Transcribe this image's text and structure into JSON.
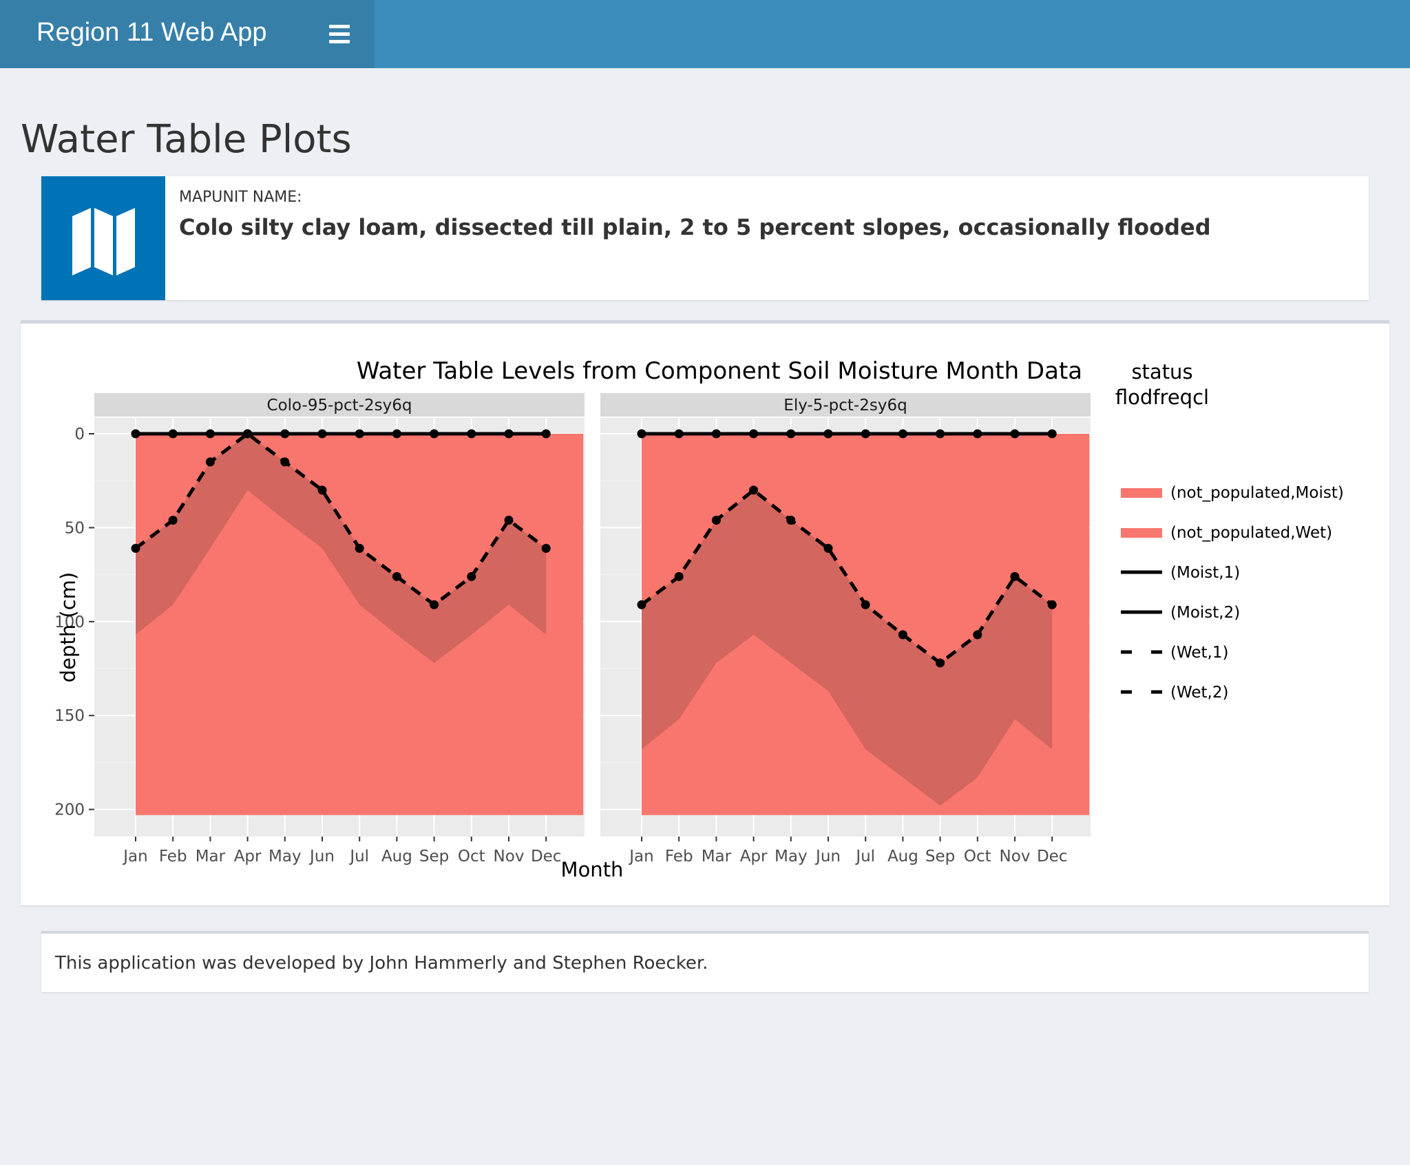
{
  "header": {
    "app_title": "Region 11 Web App",
    "menu_icon": "hamburger-icon"
  },
  "page": {
    "title": "Water Table Plots"
  },
  "mapunit": {
    "icon": "map-icon",
    "label": "MAPUNIT NAME:",
    "name": "Colo silty clay loam, dissected till plain, 2 to 5 percent slopes, occasionally flooded"
  },
  "footer": {
    "text": "This application was developed by John Hammerly and Stephen Roecker."
  },
  "colors": {
    "fill_light": "#f8766d",
    "fill_dark": "#d3665f",
    "panel_bg": "#ebebeb",
    "strip_bg": "#d9d9d9",
    "line": "#000000",
    "brand": "#3c8dbc",
    "brand_dark": "#367fa9",
    "icon_bg": "#0073b7"
  },
  "chart_data": {
    "type": "area",
    "title": "Water Table Levels from Component Soil Moisture Month Data",
    "xlabel": "Month",
    "ylabel": "depth (cm)",
    "ylim": [
      0,
      200
    ],
    "y_reversed": true,
    "y_ticks": [
      0,
      50,
      100,
      150,
      200
    ],
    "categories": [
      "Jan",
      "Feb",
      "Mar",
      "Apr",
      "May",
      "Jun",
      "Jul",
      "Aug",
      "Sep",
      "Oct",
      "Nov",
      "Dec"
    ],
    "legend": {
      "title_line1": "status",
      "title_line2": "flodfreqcl",
      "position": "right",
      "entries": [
        {
          "label": "(not_populated,Moist)",
          "kind": "fill"
        },
        {
          "label": "(not_populated,Wet)",
          "kind": "fill"
        },
        {
          "label": "(Moist,1)",
          "kind": "solid"
        },
        {
          "label": "(Moist,2)",
          "kind": "solid"
        },
        {
          "label": "(Wet,1)",
          "kind": "dashed"
        },
        {
          "label": "(Wet,2)",
          "kind": "dashed"
        }
      ]
    },
    "panels": [
      {
        "name": "Colo-95-pct-2sy6q",
        "moist_top": [
          0,
          0,
          0,
          0,
          0,
          0,
          0,
          0,
          0,
          0,
          0,
          0
        ],
        "wet_top": [
          61,
          46,
          15,
          0,
          15,
          30,
          61,
          76,
          91,
          76,
          46,
          61
        ],
        "wet_bottom": [
          107,
          91,
          61,
          30,
          46,
          61,
          91,
          107,
          122,
          107,
          91,
          107
        ]
      },
      {
        "name": "Ely-5-pct-2sy6q",
        "moist_top": [
          0,
          0,
          0,
          0,
          0,
          0,
          0,
          0,
          0,
          0,
          0,
          0
        ],
        "wet_top": [
          91,
          76,
          46,
          30,
          46,
          61,
          91,
          107,
          122,
          107,
          76,
          91
        ],
        "wet_bottom": [
          168,
          152,
          122,
          107,
          122,
          137,
          168,
          183,
          198,
          183,
          152,
          168
        ]
      }
    ]
  }
}
